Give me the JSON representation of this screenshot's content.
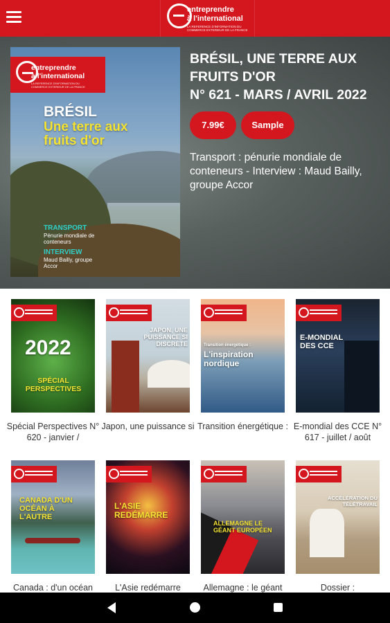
{
  "app": {
    "brand_line1": "entreprendre",
    "brand_line2": "à l'international",
    "brand_tagline": "LA REFERENCE D'INFORMATION DU COMMERCE EXTERIEUR DE LA FRANCE"
  },
  "hero": {
    "cover_title": "BRÉSIL",
    "cover_subtitle": "Une terre aux fruits d'or",
    "cover_tag1": "TRANSPORT",
    "cover_tag1_text": "Pénurie mondiale de conteneurs",
    "cover_tag2": "INTERVIEW",
    "cover_tag2_text": "Maud Bailly, groupe Accor",
    "title": "BRÉSIL, UNE TERRE AUX FRUITS D'OR\nN° 621 - MARS / AVRIL 2022",
    "price_label": "7.99€",
    "sample_label": "Sample",
    "description": "Transport : pénurie mondiale de conteneurs - Interview : Maud Bailly, groupe Accor"
  },
  "issues": [
    {
      "cover_text": "2022",
      "cover_sub": "SPÉCIAL PERSPECTIVES",
      "label": "Spécial Perspectives N° 620 - janvier /"
    },
    {
      "cover_text": "JAPON, UNE PUISSANCE SI DISCRÈTE",
      "cover_sub": "",
      "label": "Japon, une puissance si"
    },
    {
      "cover_text": "L'inspiration nordique",
      "cover_sub": "Transition énergétique :",
      "label": "Transition énergétique :"
    },
    {
      "cover_text": "E-MONDIAL DES CCE",
      "cover_sub": "",
      "label": "E-mondial des CCE N° 617 - juillet / août"
    },
    {
      "cover_text": "CANADA D'UN OCÉAN À L'AUTRE",
      "cover_sub": "",
      "label": "Canada : d'un océan"
    },
    {
      "cover_text": "L'ASIE REDÉMARRE",
      "cover_sub": "",
      "label": "L'Asie redémarre"
    },
    {
      "cover_text": "ALLEMAGNE LE GÉANT EUROPÉEN",
      "cover_sub": "",
      "label": "Allemagne : le géant"
    },
    {
      "cover_text": "ACCÉLÉRATION DU TÉLÉTRAVAIL",
      "cover_sub": "",
      "label": "Dossier :"
    }
  ],
  "icons": {
    "menu": "hamburger-menu-icon",
    "back": "back-triangle-icon",
    "home": "home-circle-icon",
    "recents": "recents-square-icon"
  },
  "colors": {
    "brand_red": "#d4171e",
    "nav_black": "#000000"
  }
}
